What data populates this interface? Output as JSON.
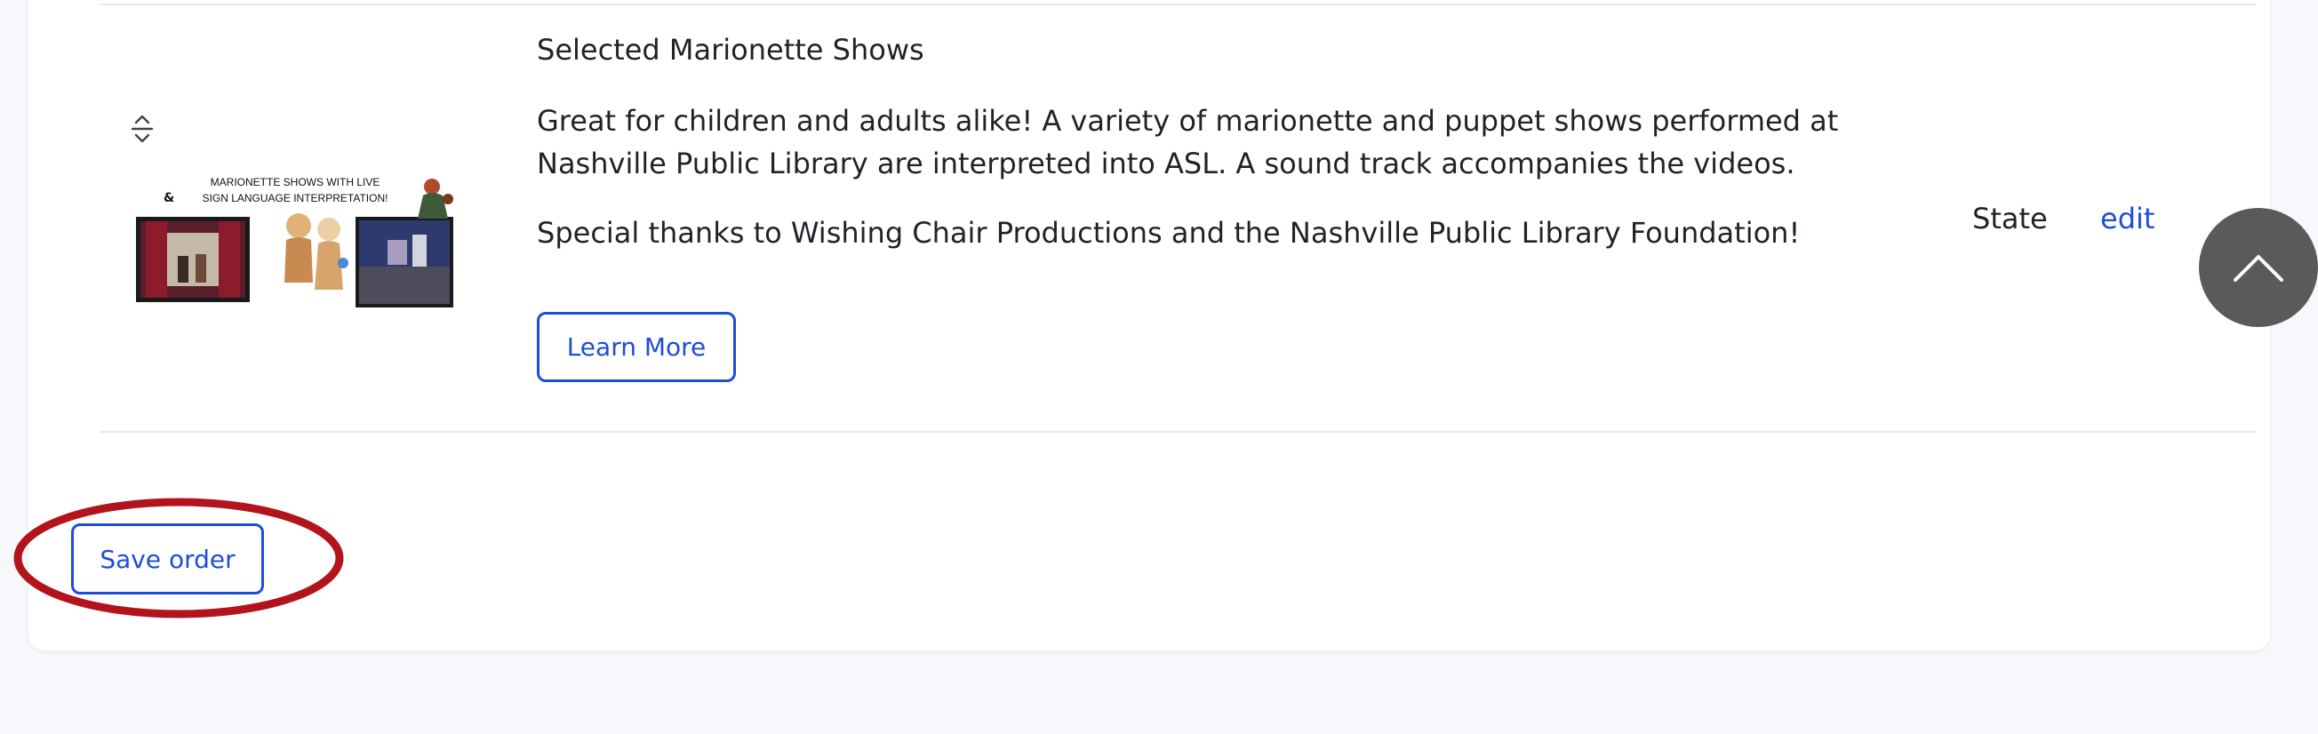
{
  "item": {
    "title": "Selected Marionette Shows",
    "description": "Great for children and adults alike! A variety of marionette and puppet shows performed at Nashville Public Library are interpreted into ASL. A sound track accompanies the videos.",
    "thanks": "Special thanks to Wishing Chair Productions and the Nashville Public Library Foundation!",
    "learn_more_label": "Learn More",
    "state_label": "State",
    "edit_label": "edit",
    "thumbnail": {
      "line1": "MARIONETTE SHOWS WITH LIVE",
      "line2": "SIGN LANGUAGE INTERPRETATION!"
    }
  },
  "footer": {
    "save_order_label": "Save order"
  },
  "icons": {
    "drag": "drag-handle-icon",
    "scroll_top": "chevron-up-icon"
  },
  "colors": {
    "accent": "#1d4ed8",
    "highlight": "#b3141c",
    "scroll_button": "#5a5a5a"
  }
}
